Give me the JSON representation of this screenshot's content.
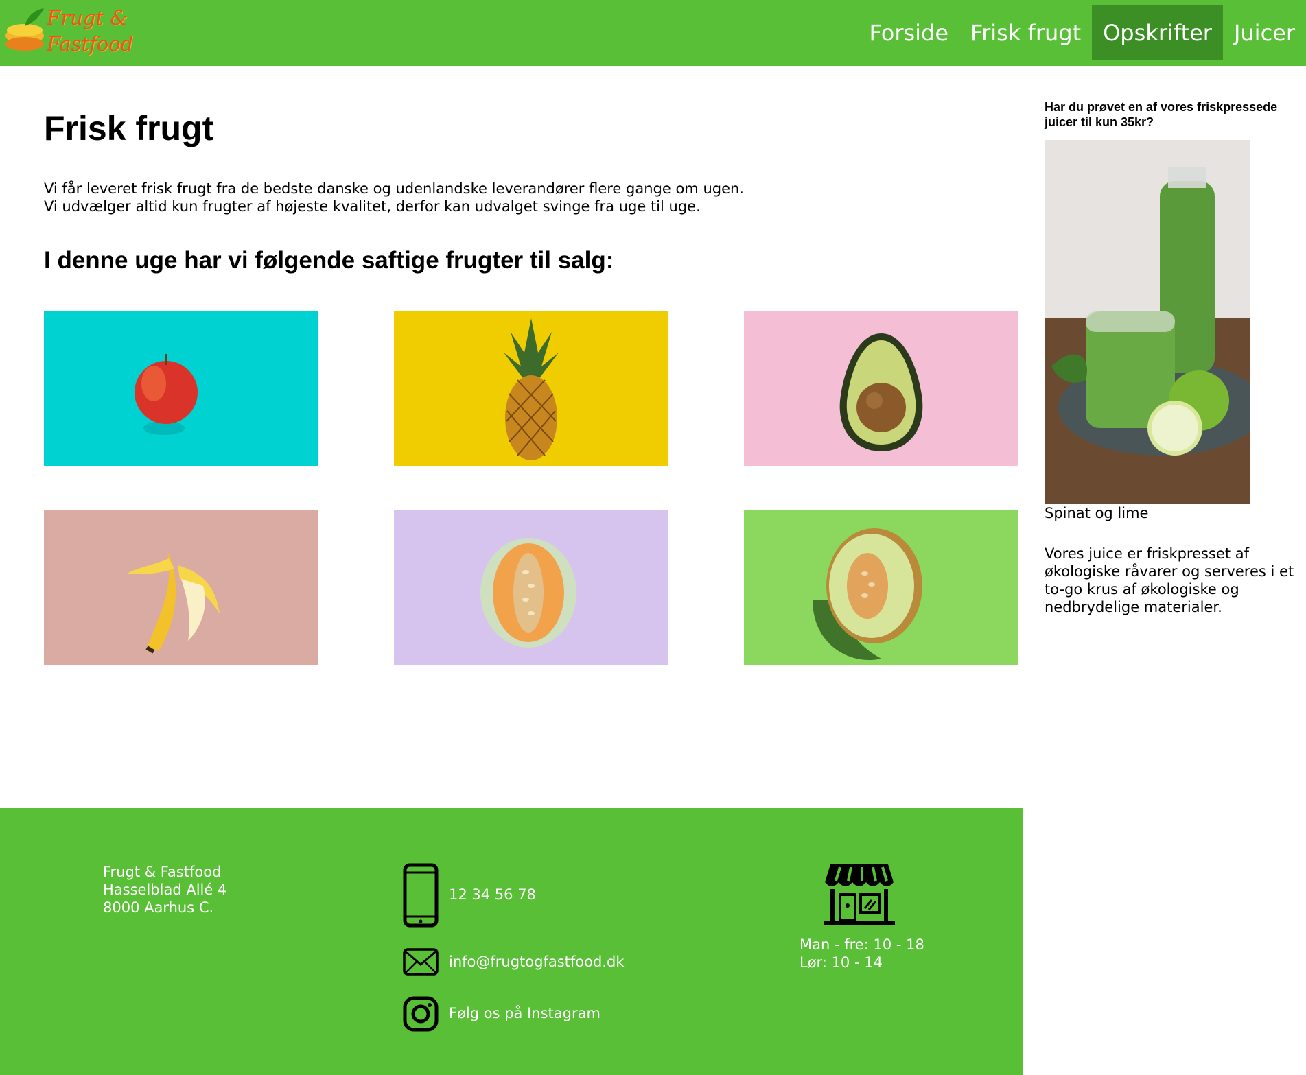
{
  "header": {
    "logo_line1": "Frugt &",
    "logo_line2": "Fastfood",
    "nav": [
      {
        "label": "Forside"
      },
      {
        "label": "Frisk frugt"
      },
      {
        "label": "Opskrifter",
        "active": true
      },
      {
        "label": "Juicer"
      }
    ]
  },
  "main": {
    "title": "Frisk frugt",
    "intro_line1": "Vi får leveret frisk frugt fra de bedste danske og udenlandske leverandører flere gange om ugen.",
    "intro_line2": "Vi udvælger altid kun frugter af højeste kvalitet, derfor kan udvalget svinge fra uge til uge.",
    "subtitle": "I denne uge har vi følgende saftige frugter til salg:",
    "fruits": [
      {
        "name": "apple",
        "bg": "#00d1d1"
      },
      {
        "name": "pineapple",
        "bg": "#f0cd00"
      },
      {
        "name": "avocado",
        "bg": "#f4bfd4"
      },
      {
        "name": "banana",
        "bg": "#d9aba3"
      },
      {
        "name": "cantaloupe",
        "bg": "#d6c3ee"
      },
      {
        "name": "honeydew",
        "bg": "#8cd75e"
      }
    ]
  },
  "aside": {
    "title": "Har du prøvet en af vores friskpressede juicer til kun 35kr?",
    "caption": "Spinat og lime",
    "text": "Vores juice er friskpresset af økologiske råvarer og serveres i et to-go krus af økologiske og nedbrydelige materialer."
  },
  "footer": {
    "name": "Frugt & Fastfood",
    "street": "Hasselblad Allé 4",
    "city": "8000 Aarhus C.",
    "phone": "12 34 56 78",
    "email": "info@frugtogfastfood.dk",
    "instagram": "Følg os på Instagram",
    "hours_weekdays": "Man - fre: 10 - 18",
    "hours_saturday": "Lør: 10 - 14"
  },
  "colors": {
    "brand_green": "#58bf37",
    "active_nav": "#3b8f25",
    "logo_orange": "#e8561a"
  }
}
